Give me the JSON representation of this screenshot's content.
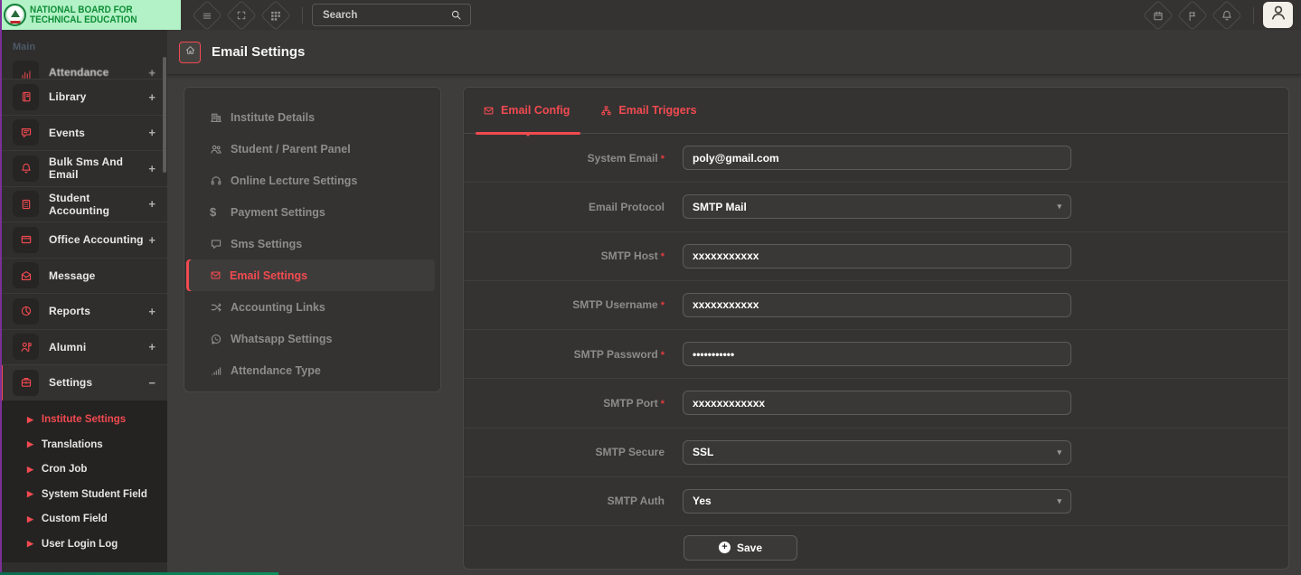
{
  "logo": {
    "line1": "NATIONAL BOARD FOR",
    "line2": "TECHNICAL EDUCATION"
  },
  "navbar": {
    "search_placeholder": "Search"
  },
  "page": {
    "title": "Email Settings"
  },
  "sidebar": {
    "section_label": "Main",
    "items": [
      {
        "label": "Attendance",
        "icon": "attendance-icon",
        "expand": "+",
        "clipped": true
      },
      {
        "label": "Library",
        "icon": "library-icon",
        "expand": "+"
      },
      {
        "label": "Events",
        "icon": "events-icon",
        "expand": "+"
      },
      {
        "label": "Bulk Sms And Email",
        "icon": "bell-icon",
        "expand": "+"
      },
      {
        "label": "Student Accounting",
        "icon": "calculator-icon",
        "expand": "+"
      },
      {
        "label": "Office Accounting",
        "icon": "credit-card-icon",
        "expand": "+"
      },
      {
        "label": "Message",
        "icon": "envelope-open-icon",
        "expand": ""
      },
      {
        "label": "Reports",
        "icon": "pie-chart-icon",
        "expand": "+"
      },
      {
        "label": "Alumni",
        "icon": "alumni-icon",
        "expand": "+"
      },
      {
        "label": "Settings",
        "icon": "briefcase-icon",
        "expand": "−",
        "active": true
      }
    ],
    "submenu": [
      {
        "label": "Institute Settings",
        "active": true
      },
      {
        "label": "Translations"
      },
      {
        "label": "Cron Job"
      },
      {
        "label": "System Student Field"
      },
      {
        "label": "Custom Field"
      },
      {
        "label": "User Login Log"
      }
    ]
  },
  "settings_nav": [
    {
      "label": "Institute Details",
      "icon": "building-icon"
    },
    {
      "label": "Student / Parent Panel",
      "icon": "users-icon"
    },
    {
      "label": "Online Lecture Settings",
      "icon": "headset-icon"
    },
    {
      "label": "Payment Settings",
      "icon": "dollar-icon"
    },
    {
      "label": "Sms Settings",
      "icon": "chat-icon"
    },
    {
      "label": "Email Settings",
      "icon": "envelope-icon",
      "active": true
    },
    {
      "label": "Accounting Links",
      "icon": "shuffle-icon"
    },
    {
      "label": "Whatsapp Settings",
      "icon": "whatsapp-icon"
    },
    {
      "label": "Attendance Type",
      "icon": "bar-chart-icon"
    }
  ],
  "form": {
    "tabs": [
      {
        "label": "Email Config",
        "icon": "envelope-icon",
        "active": true
      },
      {
        "label": "Email Triggers",
        "icon": "sitemap-icon"
      }
    ],
    "fields": [
      {
        "label": "System Email",
        "required": true,
        "control": "input",
        "value": "poly@gmail.com"
      },
      {
        "label": "Email Protocol",
        "required": false,
        "control": "select",
        "value": "SMTP Mail"
      },
      {
        "label": "SMTP Host",
        "required": true,
        "control": "input",
        "value": "xxxxxxxxxxx"
      },
      {
        "label": "SMTP Username",
        "required": true,
        "control": "input",
        "value": "xxxxxxxxxxx"
      },
      {
        "label": "SMTP Password",
        "required": true,
        "control": "password",
        "value": "•••••••••••"
      },
      {
        "label": "SMTP Port",
        "required": true,
        "control": "input",
        "value": "xxxxxxxxxxxx"
      },
      {
        "label": "SMTP Secure",
        "required": false,
        "control": "select",
        "value": "SSL"
      },
      {
        "label": "SMTP Auth",
        "required": false,
        "control": "select",
        "value": "Yes"
      }
    ],
    "save_label": "Save"
  },
  "colors": {
    "accent": "#f14a50",
    "logo_bg": "#b2f2c6",
    "logo_text": "#0e8d36"
  }
}
